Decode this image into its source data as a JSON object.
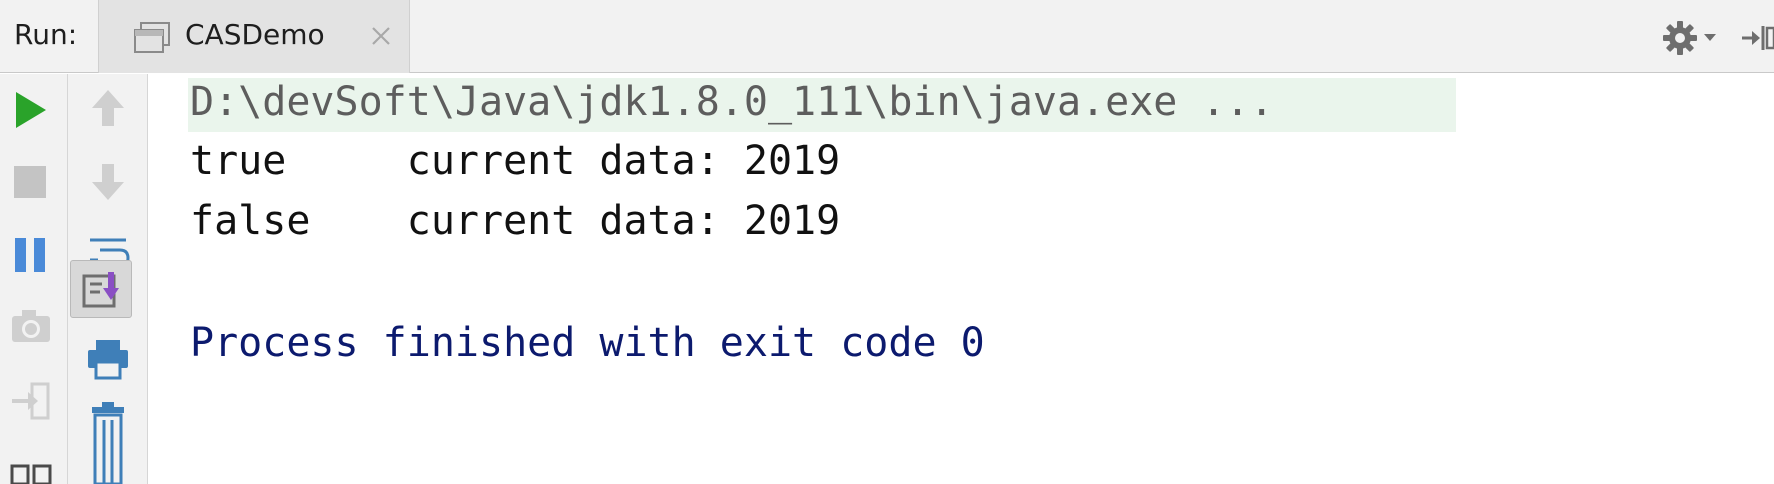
{
  "header": {
    "run_label": "Run:",
    "tab": {
      "label": "CASDemo"
    }
  },
  "left_toolbar": {
    "icons": [
      "run-icon",
      "stop-icon",
      "pause-icon",
      "camera-icon",
      "login-icon",
      "layout-icon"
    ]
  },
  "second_toolbar": {
    "icons": [
      "up-arrow-icon",
      "down-arrow-icon",
      "soft-wrap-icon",
      "scroll-to-end-icon",
      "print-icon",
      "trash-icon"
    ]
  },
  "console": {
    "command": "D:\\devSoft\\Java\\jdk1.8.0_111\\bin\\java.exe ...",
    "output_lines": [
      "true     current data: 2019",
      "false    current data: 2019"
    ],
    "exit_message": "Process finished with exit code 0"
  },
  "colors": {
    "run_green": "#2aa32a",
    "pause_blue": "#4a8ad8",
    "exit_text": "#0c1a6e",
    "command_bg": "#eaf5ec",
    "command_text": "#5d5d5d"
  }
}
